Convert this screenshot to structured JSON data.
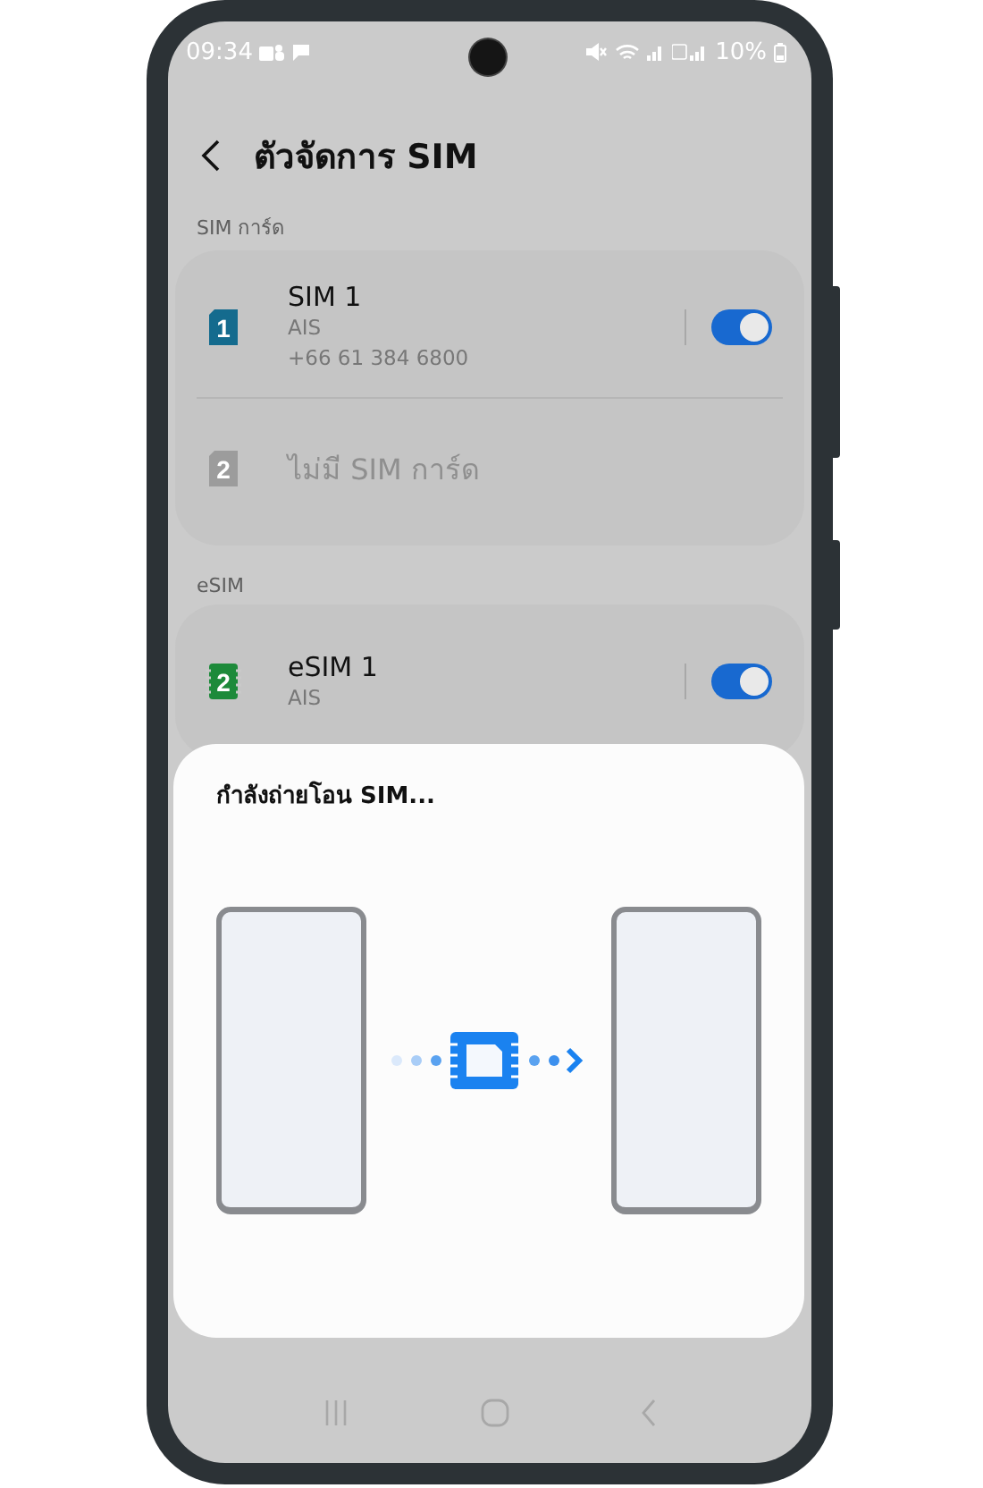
{
  "status_bar": {
    "time": "09:34",
    "battery": "10%"
  },
  "header": {
    "title": "ตัวจัดการ SIM"
  },
  "sections": [
    {
      "title": "SIM การ์ด",
      "items": [
        {
          "kind": "sim",
          "badge": "1",
          "name": "SIM 1",
          "carrier": "AIS",
          "number": "+66 61 384 6800",
          "on": true,
          "disabled": false
        },
        {
          "kind": "sim",
          "badge": "2",
          "name": "ไม่มี SIM การ์ด",
          "disabled": true
        }
      ]
    },
    {
      "title": "eSIM",
      "items": [
        {
          "kind": "esim",
          "badge": "2",
          "name": "eSIM 1",
          "carrier": "AIS",
          "on": true,
          "disabled": false
        }
      ]
    }
  ],
  "sheet": {
    "title": "กำลังถ่ายโอน SIM..."
  }
}
